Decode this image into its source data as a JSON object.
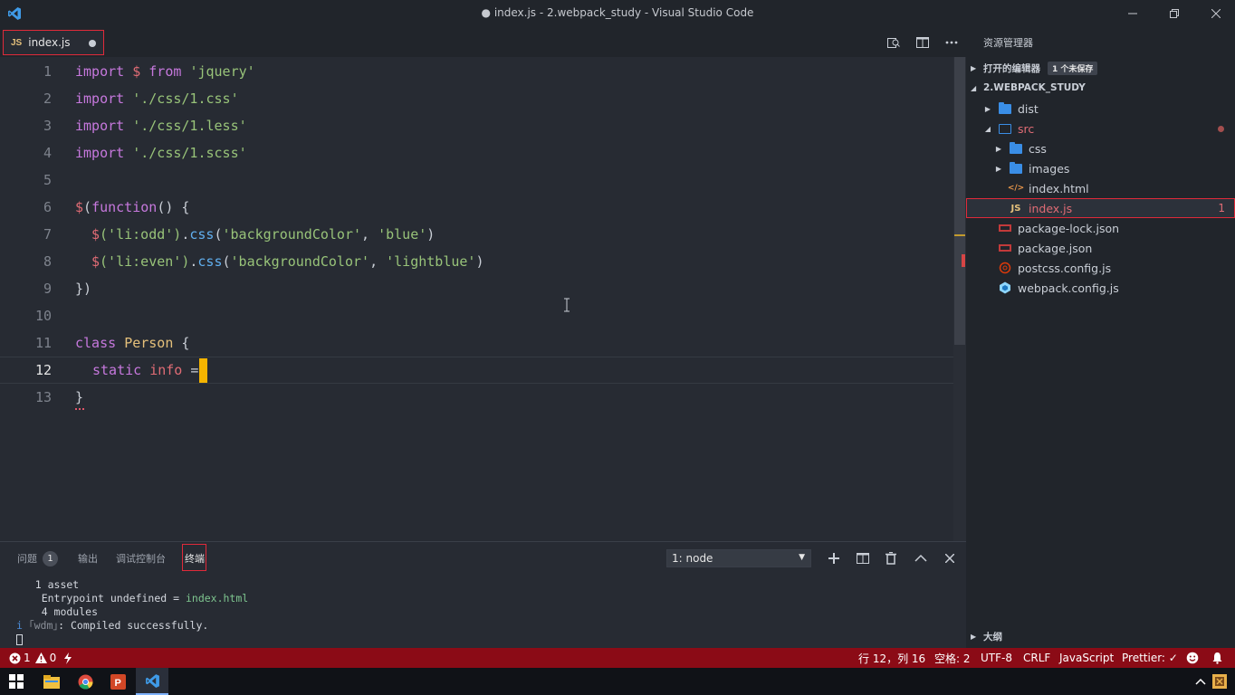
{
  "window": {
    "title": "● index.js - 2.webpack_study - Visual Studio Code"
  },
  "tabs": [
    {
      "label": "index.js",
      "badge": "JS",
      "dirty": true
    }
  ],
  "editor": {
    "lines": [
      {
        "n": "1"
      },
      {
        "n": "2"
      },
      {
        "n": "3"
      },
      {
        "n": "4"
      },
      {
        "n": "5"
      },
      {
        "n": "6"
      },
      {
        "n": "7"
      },
      {
        "n": "8"
      },
      {
        "n": "9"
      },
      {
        "n": "10"
      },
      {
        "n": "11"
      },
      {
        "n": "12"
      },
      {
        "n": "13"
      }
    ],
    "code": {
      "l1": [
        "import",
        "$",
        "from",
        "'jquery'"
      ],
      "l2": [
        "import",
        "'./css/1.css'"
      ],
      "l3": [
        "import",
        "'./css/1.less'"
      ],
      "l4": [
        "import",
        "'./css/1.scss'"
      ],
      "l6": [
        "$",
        "(",
        "function",
        "() {"
      ],
      "l7": [
        "$",
        "('li:odd')",
        ".",
        "css",
        "(",
        "'backgroundColor'",
        ", ",
        "'blue'",
        ")"
      ],
      "l8": [
        "$",
        "('li:even')",
        ".",
        "css",
        "(",
        "'backgroundColor'",
        ", ",
        "'lightblue'",
        ")"
      ],
      "l9": "})",
      "l11": [
        "class",
        "Person",
        "{"
      ],
      "l12": [
        "static",
        "info",
        "="
      ],
      "l13": "}"
    }
  },
  "panel": {
    "tabs": [
      {
        "label": "问题",
        "count": "1"
      },
      {
        "label": "输出"
      },
      {
        "label": "调试控制台"
      },
      {
        "label": "终端",
        "active": true
      }
    ],
    "terminal_select": "1: node",
    "terminal_lines": {
      "l1": "   1 asset",
      "l2a": "Entrypoint ",
      "l2b": "undefined",
      "l2c": " = ",
      "l2d": "index.html",
      "l3": "    4 modules",
      "l4a": "i ",
      "l4b": "｢wdm｣",
      "l4c": ": Compiled successfully."
    }
  },
  "sidebar": {
    "title": "资源管理器",
    "open_editors": {
      "label": "打开的编辑器",
      "badge": "1 个未保存"
    },
    "project": {
      "label": "2.WEBPACK_STUDY"
    },
    "tree": [
      {
        "label": "dist",
        "type": "folder"
      },
      {
        "label": "src",
        "type": "folder-open"
      },
      {
        "label": "css",
        "type": "folder"
      },
      {
        "label": "images",
        "type": "folder"
      },
      {
        "label": "index.html",
        "type": "html"
      },
      {
        "label": "index.js",
        "type": "js",
        "errors": "1"
      },
      {
        "label": "package-lock.json",
        "type": "json"
      },
      {
        "label": "package.json",
        "type": "json"
      },
      {
        "label": "postcss.config.js",
        "type": "postcss"
      },
      {
        "label": "webpack.config.js",
        "type": "webpack"
      }
    ],
    "outline": {
      "label": "大纲"
    }
  },
  "statusbar": {
    "errors": "1",
    "warnings": "0",
    "position": "行 12，列 16",
    "spaces": "空格: 2",
    "encoding": "UTF-8",
    "eol": "CRLF",
    "language": "JavaScript",
    "formatter": "Prettier: ✓"
  },
  "colors": {
    "statusbar": "#8b0b16",
    "accent_outline": "#e02a3a",
    "cursor": "#f5b400"
  }
}
